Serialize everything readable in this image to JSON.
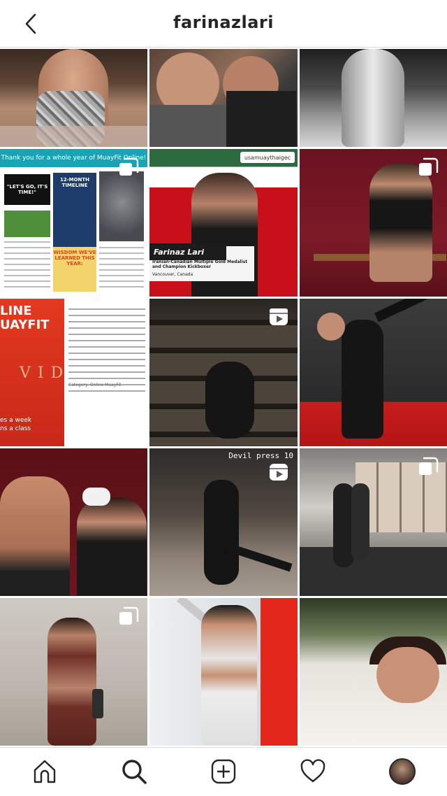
{
  "header": {
    "title": "farinazlari",
    "back_icon": "chevron-left-icon"
  },
  "grid": {
    "tiles": [
      {
        "icon": null
      },
      {
        "icon": null
      },
      {
        "icon": null
      },
      {
        "icon": "multiple-photos-icon",
        "header": "Thank you for a whole year of MuayFit Online!",
        "box1": "\"LET'S GO, IT'S TIME!\"",
        "timeline": "12-MONTH TIMELINE",
        "wisdom": "WISDOM WE'VE LEARNED THIS YEAR:"
      },
      {
        "icon": null,
        "tag": "usamuaythaigec",
        "name": "Farinaz Lari",
        "caption": "Iranian-Canadian Multiple Gold Medalist and Champion Kickboxer",
        "city": "Vancouver, Canada"
      },
      {
        "icon": "multiple-photos-icon"
      },
      {
        "icon": null,
        "big_text": "LINE\nUAYFIT",
        "videos": "VIDEOS",
        "bottom_text": "es a week\nns a class",
        "category": "Category: Online MuayFit"
      },
      {
        "icon": "reels-icon"
      },
      {
        "icon": null
      },
      {
        "icon": null
      },
      {
        "icon": "reels-icon",
        "label": "Devil press 10"
      },
      {
        "icon": "multiple-photos-icon"
      },
      {
        "icon": "multiple-photos-icon"
      },
      {
        "icon": null
      },
      {
        "icon": null
      }
    ]
  },
  "tabbar": {
    "items": [
      {
        "name": "home",
        "icon": "home-icon"
      },
      {
        "name": "search",
        "icon": "search-icon"
      },
      {
        "name": "new-post",
        "icon": "plus-square-icon"
      },
      {
        "name": "activity",
        "icon": "heart-icon"
      },
      {
        "name": "profile",
        "icon": "avatar"
      }
    ]
  },
  "colors": {
    "text": "#262626",
    "divider": "#dbdbdb",
    "background": "#ffffff"
  }
}
